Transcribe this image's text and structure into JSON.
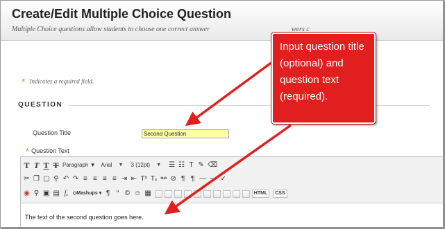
{
  "page": {
    "title": "Create/Edit Multiple Choice Question",
    "description": "Multiple Choice questions allow students to choose one correct answer",
    "description_tail": "wers c"
  },
  "required_note": {
    "star": "*",
    "text": "Indicates a required field."
  },
  "section": {
    "title": "QUESTION"
  },
  "question_title": {
    "label": "Question Title",
    "value": "Second Question"
  },
  "question_text": {
    "required_star": "*",
    "label": "Question Text"
  },
  "toolbar": {
    "row1": {
      "format_block": "Paragraph",
      "font_family": "Arial",
      "font_size": "3 (12pt)"
    },
    "row3": {
      "mashups": "Mashups",
      "html": "HTML",
      "css": "CSS"
    }
  },
  "editor": {
    "content": "The text of the second question goes here."
  },
  "callout": {
    "text": "Input question title (optional) and question text (required).",
    "color": "#e21f1f"
  },
  "colors": {
    "required_star": "#e58a1f",
    "title_input_bg": "#ffffa8",
    "arrow": "#e21f1f"
  }
}
